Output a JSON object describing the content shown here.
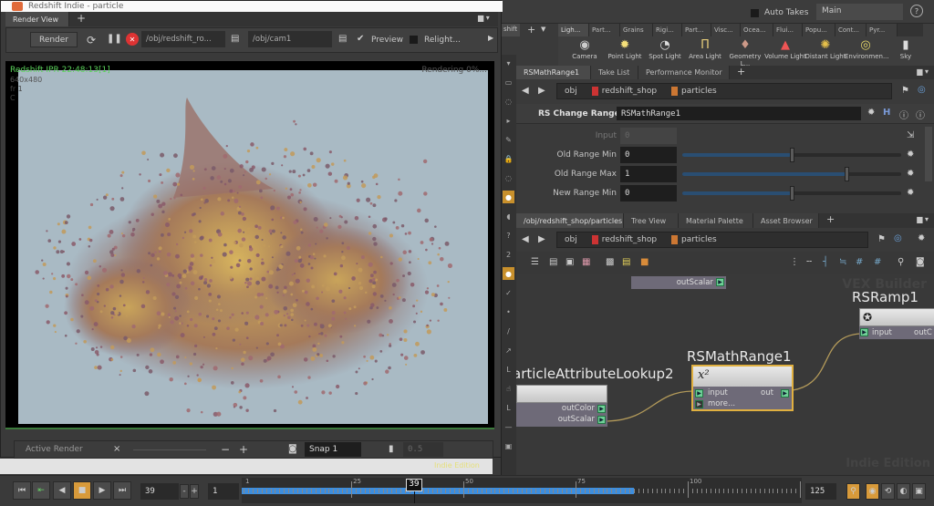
{
  "render_window": {
    "title": "Redshift Indie - particle",
    "tab": "Render View",
    "render_button": "Render",
    "rop_path": "/obj/redshift_ro...",
    "camera_path": "/obj/cam1",
    "preview_label": "Preview",
    "relight_label": "Relight...",
    "overlay": {
      "status": "Redshift IPR  22:48:13[1]",
      "resolution": "640x480",
      "frame": "fr 1",
      "channel": "C",
      "progress": "Rendering 0%..."
    },
    "bottom": {
      "active_render": "Active Render",
      "snap": "Snap 1",
      "value": "0.5",
      "minus": "−",
      "plus": "+"
    },
    "indie_edition": "Indie Edition"
  },
  "top_bar": {
    "auto_takes": "Auto Takes",
    "take": "Main",
    "left_tab": "shift"
  },
  "shelf": {
    "tabs": [
      "Ligh...",
      "Part...",
      "Grains",
      "Rigi...",
      "Part...",
      "Visc...",
      "Ocea...",
      "Flui...",
      "Popu...",
      "Cont...",
      "Pyr..."
    ],
    "tools": [
      {
        "label": "Camera",
        "icon": "◉"
      },
      {
        "label": "Point Light",
        "icon": "✹"
      },
      {
        "label": "Spot Light",
        "icon": "◔"
      },
      {
        "label": "Area Light",
        "icon": "Π"
      },
      {
        "label": "Geometry L...",
        "icon": "♦"
      },
      {
        "label": "Volume Light",
        "icon": "▲"
      },
      {
        "label": "Distant Light",
        "icon": "✺"
      },
      {
        "label": "Environmen...",
        "icon": "◎"
      },
      {
        "label": "Sky",
        "icon": "▮"
      }
    ]
  },
  "param_pane": {
    "tabs": [
      "RSMathRange1",
      "Take List",
      "Performance Monitor"
    ],
    "path": [
      "obj",
      "redshift_shop",
      "particles"
    ],
    "node_type": "RS Change Range",
    "node_name": "RSMathRange1",
    "params": [
      {
        "label": "Input",
        "value": "0",
        "fraction": null
      },
      {
        "label": "Old Range Min",
        "value": "0",
        "fraction": 0.5
      },
      {
        "label": "Old Range Max",
        "value": "1",
        "fraction": 0.75
      },
      {
        "label": "New Range Min",
        "value": "0",
        "fraction": 0.5
      }
    ]
  },
  "network_pane": {
    "tabs": [
      "/obj/redshift_shop/particles",
      "Tree View",
      "Material Palette",
      "Asset Browser"
    ],
    "path": [
      "obj",
      "redshift_shop",
      "particles"
    ],
    "watermark": "VEX Builder",
    "watermark2": "Indie Edition",
    "nodes": {
      "top_out": "outScalar",
      "ramp": {
        "title": "RSRamp1",
        "in": "input",
        "out": "outC"
      },
      "math": {
        "title": "RSMathRange1",
        "icon": "x²",
        "in": "input",
        "more": "more...",
        "out": "out"
      },
      "lookup": {
        "title": "articleAttributeLookup2",
        "out1": "outColor",
        "out2": "outScalar"
      }
    }
  },
  "timeline": {
    "current_frame": "39",
    "step": "1",
    "start": "1",
    "end": "125",
    "ticks": [
      "1",
      "25",
      "50",
      "75",
      "100"
    ],
    "marker": "39",
    "cached_fraction": 0.7
  }
}
